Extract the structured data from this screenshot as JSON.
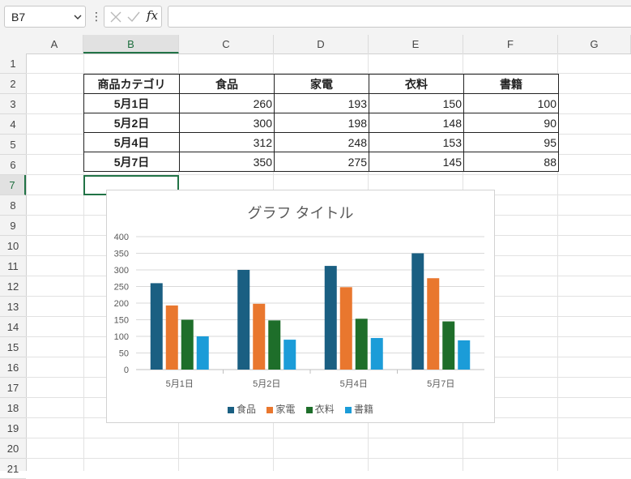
{
  "formula_bar": {
    "name_box": "B7",
    "fx_label": "fx",
    "formula": ""
  },
  "columns": [
    "A",
    "B",
    "C",
    "D",
    "E",
    "F",
    "G"
  ],
  "selected_column": "B",
  "rows": [
    "1",
    "2",
    "3",
    "4",
    "5",
    "6",
    "7",
    "8",
    "9",
    "10",
    "11",
    "12",
    "13",
    "14",
    "15",
    "16",
    "17",
    "18",
    "19",
    "20",
    "21"
  ],
  "selected_row": "7",
  "table": {
    "headers": [
      "商品カテゴリ",
      "食品",
      "家電",
      "衣料",
      "書籍"
    ],
    "rows": [
      {
        "label": "5月1日",
        "values": [
          "260",
          "193",
          "150",
          "100"
        ]
      },
      {
        "label": "5月2日",
        "values": [
          "300",
          "198",
          "148",
          "90"
        ]
      },
      {
        "label": "5月4日",
        "values": [
          "312",
          "248",
          "153",
          "95"
        ]
      },
      {
        "label": "5月7日",
        "values": [
          "350",
          "275",
          "145",
          "88"
        ]
      }
    ]
  },
  "colors": {
    "series": [
      "#1a5f82",
      "#e9772e",
      "#1e6e2a",
      "#1b9cd8"
    ],
    "selection": "#217346"
  },
  "chart_data": {
    "type": "bar",
    "title": "グラフ タイトル",
    "categories": [
      "5月1日",
      "5月2日",
      "5月4日",
      "5月7日"
    ],
    "series": [
      {
        "name": "食品",
        "values": [
          260,
          300,
          312,
          350
        ]
      },
      {
        "name": "家電",
        "values": [
          193,
          198,
          248,
          275
        ]
      },
      {
        "name": "衣料",
        "values": [
          150,
          148,
          153,
          145
        ]
      },
      {
        "name": "書籍",
        "values": [
          100,
          90,
          95,
          88
        ]
      }
    ],
    "y_ticks": [
      "0",
      "50",
      "100",
      "150",
      "200",
      "250",
      "300",
      "350",
      "400"
    ],
    "ylim": [
      0,
      400
    ],
    "grid": true,
    "legend_position": "bottom"
  }
}
